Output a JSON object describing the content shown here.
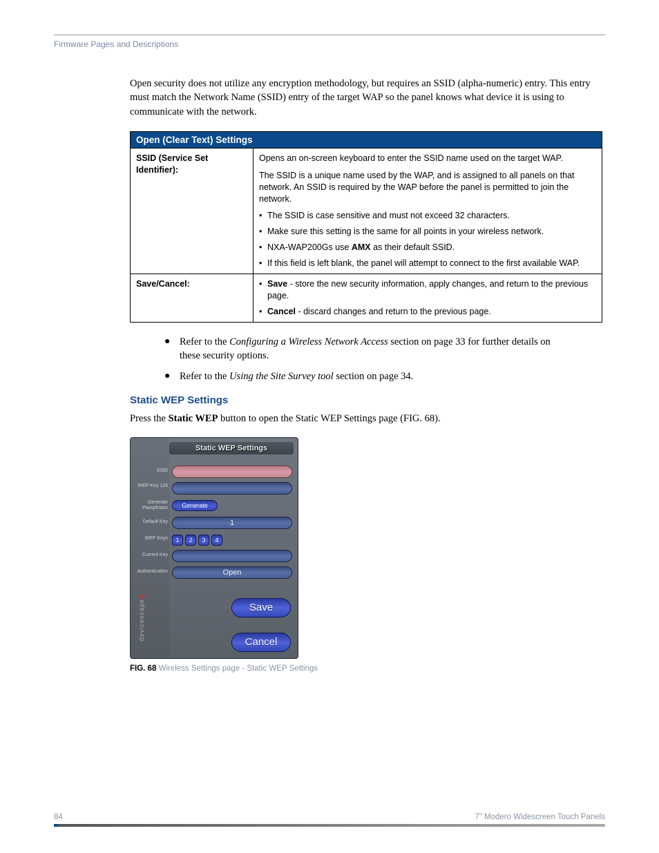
{
  "header": {
    "section": "Firmware Pages and Descriptions"
  },
  "intro_para": "Open security does not utilize any encryption methodology, but requires an SSID (alpha-numeric) entry. This entry must match the Network Name (SSID) entry of the target WAP so the panel knows what device it is using to communicate with the network.",
  "table": {
    "title": "Open (Clear Text) Settings",
    "rows": [
      {
        "head": "SSID (Service Set Identifier):",
        "para1": "Opens an on-screen keyboard to enter the SSID name used on the target WAP.",
        "para2": "The SSID is a unique name used by the WAP, and is assigned to all panels on that network. An SSID is required by the WAP before the panel is permitted to join the network.",
        "b1": "The SSID is case sensitive and must not exceed 32 characters.",
        "b2": "Make sure this setting is the same for all points in your wireless network.",
        "b3_pre": "NXA-WAP200Gs use ",
        "b3_bold": "AMX",
        "b3_post": " as their default SSID.",
        "b4": "If this field is left blank, the panel will attempt to connect to the first available WAP."
      },
      {
        "head": "Save/Cancel:",
        "sb1_bold": "Save",
        "sb1_rest": " - store the new security information, apply changes, and return to the previous page.",
        "sb2_bold": "Cancel",
        "sb2_rest": " - discard changes and return to the previous page."
      }
    ]
  },
  "outer_bullets": {
    "b1_pre": "Refer to the ",
    "b1_italic": "Configuring a Wireless Network Access",
    "b1_post": " section on page 33 for further details on these security options.",
    "b2_pre": "Refer to the ",
    "b2_italic": "Using the Site Survey tool",
    "b2_post": " section on page 34."
  },
  "section_heading": "Static WEP Settings",
  "press_para_pre": "Press the ",
  "press_para_bold": "Static WEP",
  "press_para_post": " button to open the Static WEP Settings page (FIG. 68).",
  "panel": {
    "title": "Static WEP Settings",
    "labels": {
      "ssid": "SSID",
      "wep": "WEP Key 128",
      "gen": "Generate Passphrase",
      "defkey": "Default Key",
      "wepkeys": "WEP Keys",
      "curkey": "Current Key",
      "auth": "Authentication"
    },
    "generate_btn": "Generate",
    "default_key_value": "1",
    "key_pills": [
      "1",
      "2",
      "3",
      "4"
    ],
    "auth_value": "Open",
    "save_btn": "Save",
    "cancel_btn": "Cancel",
    "brand": "devicescape",
    "brand_e": "e"
  },
  "figure": {
    "num": "FIG. 68",
    "caption": "Wireless Settings page - Static WEP Settings"
  },
  "footer": {
    "page_num": "84",
    "doc_title": "7\" Modero Widescreen Touch Panels"
  }
}
